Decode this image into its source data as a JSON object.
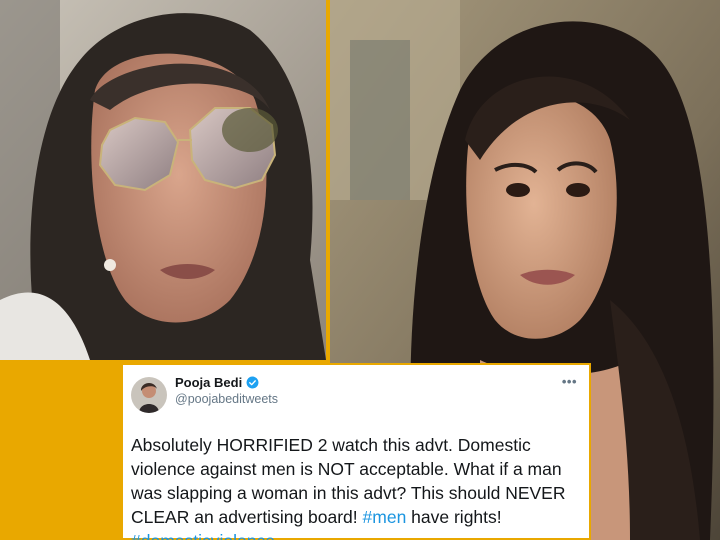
{
  "tweet": {
    "display_name": "Pooja Bedi",
    "handle": "@poojabeditweets",
    "text_parts": [
      "Absolutely HORRIFIED 2 watch this advt. Domestic violence against men is NOT acceptable. What if a man was slapping a woman in this advt? This should NEVER CLEAR an advertising board! ",
      "#men",
      " have rights! ",
      "#domesticviolence"
    ]
  },
  "colors": {
    "frame": "#e9a800",
    "hashtag": "#1b95e0",
    "verified": "#1da1f2",
    "text": "#14171a",
    "muted": "#657786"
  },
  "icons": {
    "verified": "verified-badge-icon",
    "more": "more-options-icon"
  }
}
